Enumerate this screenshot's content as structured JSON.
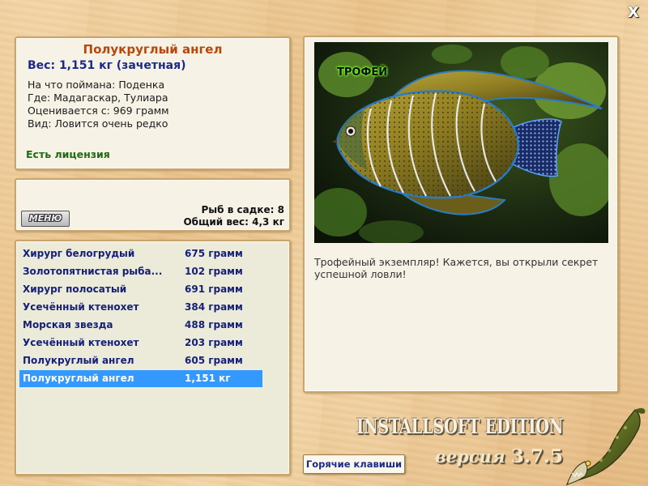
{
  "window": {
    "close_glyph": "X"
  },
  "info": {
    "fish_name": "Полукруглый ангел",
    "weight": "Вес: 1,151 кг (зачетная)",
    "bait": "На что поймана: Поденка",
    "location": "Где: Мадагаскар, Тулиара",
    "valued_from": "Оценивается с: 969 грамм",
    "rarity": "Вид: Ловится очень редко",
    "license": "Есть лицензия"
  },
  "keeper": {
    "menu_label": "МЕНЮ",
    "fish_count": "Рыб в садке: 8",
    "total_weight": "Общий вес: 4,3 кг"
  },
  "catch_list": [
    {
      "name": "Хирург белогрудый",
      "weight": "675 грамм"
    },
    {
      "name": "Золотопятнистая рыба...",
      "weight": "102 грамм"
    },
    {
      "name": "Хирург полосатый",
      "weight": "691 грамм"
    },
    {
      "name": "Усечённый ктенохет",
      "weight": "384 грамм"
    },
    {
      "name": "Морская звезда",
      "weight": "488 грамм"
    },
    {
      "name": "Усечённый ктенохет",
      "weight": "203 грамм"
    },
    {
      "name": "Полукруглый ангел",
      "weight": "605 грамм"
    },
    {
      "name": "Полукруглый ангел",
      "weight": "1,151 кг",
      "selected": true
    }
  ],
  "picture": {
    "badge": "ТРОФЕЙ",
    "comment": "Трофейный экземпляр! Кажется, вы открыли секрет успешной ловли!"
  },
  "footer": {
    "hotkeys_label": "Горячие клавиши",
    "brand": "INSTALLSOFT EDITION",
    "version_prefix": "версия",
    "version_number": "3.7.5"
  },
  "icons": {
    "close": "close-icon",
    "fish_photo": "fish-photo",
    "logo": "pike-icon"
  },
  "colors": {
    "title": "#b8470c",
    "weight": "#1a2a8a",
    "license": "#1e6b12",
    "selection": "#3399ff"
  }
}
